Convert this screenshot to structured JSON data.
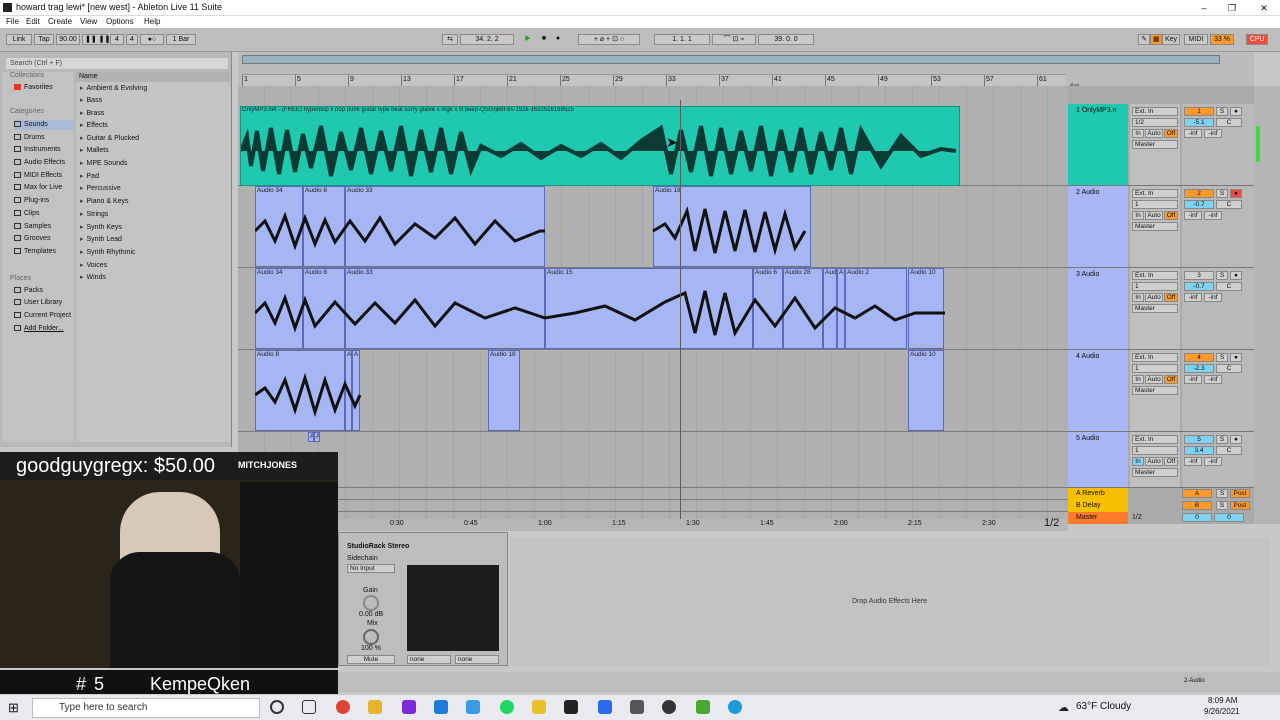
{
  "window": {
    "title": "howard trag lewi*  [new west]  - Ableton Live 11 Suite",
    "minimize": "–",
    "maximize": "❐",
    "close": "✕"
  },
  "menu": [
    "File",
    "Edit",
    "Create",
    "View",
    "Options",
    "Help"
  ],
  "transport": {
    "link": "Link",
    "tap": "Tap",
    "tempo": "90.00",
    "meter_num": "4",
    "meter_den": "4",
    "quant": "1 Bar",
    "position": "34.  2.  2",
    "loop_start": "1.  1.  1",
    "loop_length": "39.  0.  0",
    "key": "Key",
    "midi": "MIDI",
    "cpu_pct": "33 %",
    "cpu": "CPU"
  },
  "browser": {
    "search_placeholder": "Search (Ctrl + F)",
    "collections_header": "Collections",
    "favorites": "Favorites",
    "categories_header": "Categories",
    "categories": [
      "Sounds",
      "Drums",
      "Instruments",
      "Audio Effects",
      "MIDI Effects",
      "Max for Live",
      "Plug-ins",
      "Clips",
      "Samples",
      "Grooves",
      "Templates"
    ],
    "places_header": "Places",
    "places": [
      "Packs",
      "User Library",
      "Current Project",
      "Add Folder..."
    ],
    "name_header": "Name",
    "names": [
      "Ambient & Evolving",
      "Bass",
      "Brass",
      "Effects",
      "Guitar & Plucked",
      "Mallets",
      "MPE Sounds",
      "Pad",
      "Percussive",
      "Piano & Keys",
      "Strings",
      "Synth Keys",
      "Synth Lead",
      "Synth Rhythmic",
      "Voices",
      "Winds"
    ]
  },
  "ruler": {
    "bars": [
      "1",
      "5",
      "9",
      "13",
      "17",
      "21",
      "25",
      "29",
      "33",
      "37",
      "41",
      "45",
      "49",
      "53",
      "57",
      "61"
    ],
    "set": "Set"
  },
  "time_ruler": [
    "0:30",
    "0:45",
    "1:00",
    "1:15",
    "1:30",
    "1:45",
    "2:00",
    "2:15",
    "2:30"
  ],
  "page_indicator": "1/2",
  "tracks": [
    {
      "name": "1 OnlyMP3.n",
      "input": "Ext. In",
      "channel": "1/2",
      "monitor": [
        "In",
        "Auto",
        "Off"
      ],
      "out": "Master",
      "num": "1",
      "vol": "-5.1",
      "pan": "C",
      "send_a": "-inf",
      "send_b": "-inf",
      "clip_title": "OnlyMP3.net - (FREE) hyperpop x pop punk guitar type beat sorry glaive x mgk x lil peep-QSGrje8f-8s-192k-1632516169525"
    },
    {
      "name": "2 Audio",
      "input": "Ext. In",
      "channel": "1",
      "monitor": [
        "In",
        "Auto",
        "Off"
      ],
      "out": "Master",
      "num": "2",
      "vol": "-0.7",
      "pan": "C",
      "send_a": "-inf",
      "send_b": "-inf",
      "clips": [
        "Audio 34",
        "Audio 8",
        "Audio 33",
        "Audio 18"
      ]
    },
    {
      "name": "3 Audio",
      "input": "Ext. In",
      "channel": "1",
      "monitor": [
        "In",
        "Auto",
        "Off"
      ],
      "out": "Master",
      "num": "3",
      "vol": "-0.7",
      "pan": "C",
      "send_a": "-inf",
      "send_b": "-inf",
      "clips": [
        "Audio 34",
        "Audio 8",
        "Audio 33",
        "Audio 15",
        "Audio 6",
        "Audio 28",
        "Aud",
        "A",
        "Audio 2",
        "Audio 10"
      ]
    },
    {
      "name": "4 Audio",
      "input": "Ext. In",
      "channel": "1",
      "monitor": [
        "In",
        "Auto",
        "Off"
      ],
      "out": "Master",
      "num": "4",
      "vol": "-2.3",
      "pan": "C",
      "send_a": "-inf",
      "send_b": "-inf",
      "clips": [
        "Audio 8",
        "A",
        "A",
        "Audio 18",
        "Audio 10"
      ]
    },
    {
      "name": "5 Audio",
      "input": "Ext. In",
      "channel": "1",
      "monitor": [
        "In",
        "Auto",
        "Off"
      ],
      "out": "Master",
      "num": "5",
      "vol": "3.4",
      "pan": "C",
      "send_a": "-inf",
      "send_b": "-inf",
      "clips": [
        "A",
        "A"
      ]
    }
  ],
  "returns": [
    {
      "name": "A Reverb",
      "letter": "A",
      "s": "S",
      "post": "Post"
    },
    {
      "name": "B Delay",
      "letter": "B",
      "s": "S",
      "post": "Post"
    },
    {
      "name": "Master",
      "channel": "1/2",
      "num": "0",
      "vol": "0"
    }
  ],
  "device": {
    "name": "StudioRack Stereo",
    "sidechain": "Sidechain",
    "sidechain_value": "No Input",
    "gain": "Gain",
    "gain_value": "0.00 dB",
    "mix": "Mix",
    "mix_value": "100 %",
    "mute": "Mute",
    "sel1": "none",
    "sel2": "none"
  },
  "drop_text": "Drop Audio Effects Here",
  "status": {
    "track": "2-Audio"
  },
  "stream": {
    "donation": "goodguygregx: $50.00",
    "brand": "MITCHJONES",
    "hash": "#",
    "hash_num": "5",
    "streamer": "KempeQken"
  },
  "taskbar": {
    "search_placeholder": "Type here to search",
    "weather": "63°F  Cloudy",
    "time": "8:09 AM",
    "date": "9/26/2021"
  }
}
